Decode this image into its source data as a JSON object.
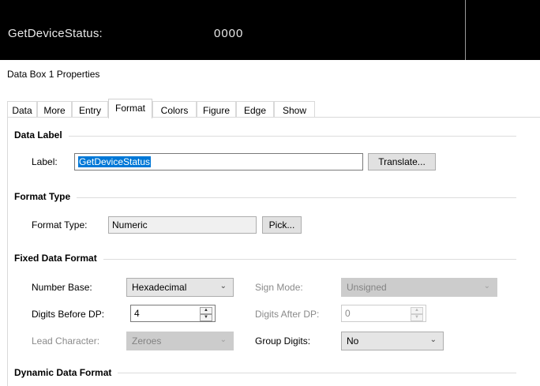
{
  "preview": {
    "label": "GetDeviceStatus:",
    "value": "0000"
  },
  "dialog_title": "Data Box 1 Properties",
  "tabs": [
    "Data",
    "More",
    "Entry",
    "Format",
    "Colors",
    "Figure",
    "Edge",
    "Show"
  ],
  "active_tab": "Format",
  "data_label": {
    "heading": "Data Label",
    "label_caption": "Label:",
    "label_value": "GetDeviceStatus",
    "translate_button": "Translate..."
  },
  "format_type": {
    "heading": "Format Type",
    "caption": "Format Type:",
    "value": "Numeric",
    "pick_button": "Pick..."
  },
  "fixed_data_format": {
    "heading": "Fixed Data Format",
    "number_base_caption": "Number Base:",
    "number_base_value": "Hexadecimal",
    "sign_mode_caption": "Sign Mode:",
    "sign_mode_value": "Unsigned",
    "digits_before_caption": "Digits Before DP:",
    "digits_before_value": "4",
    "digits_after_caption": "Digits After DP:",
    "digits_after_value": "0",
    "lead_char_caption": "Lead Character:",
    "lead_char_value": "Zeroes",
    "group_digits_caption": "Group Digits:",
    "group_digits_value": "No"
  },
  "dynamic_data_format": {
    "heading": "Dynamic Data Format"
  }
}
